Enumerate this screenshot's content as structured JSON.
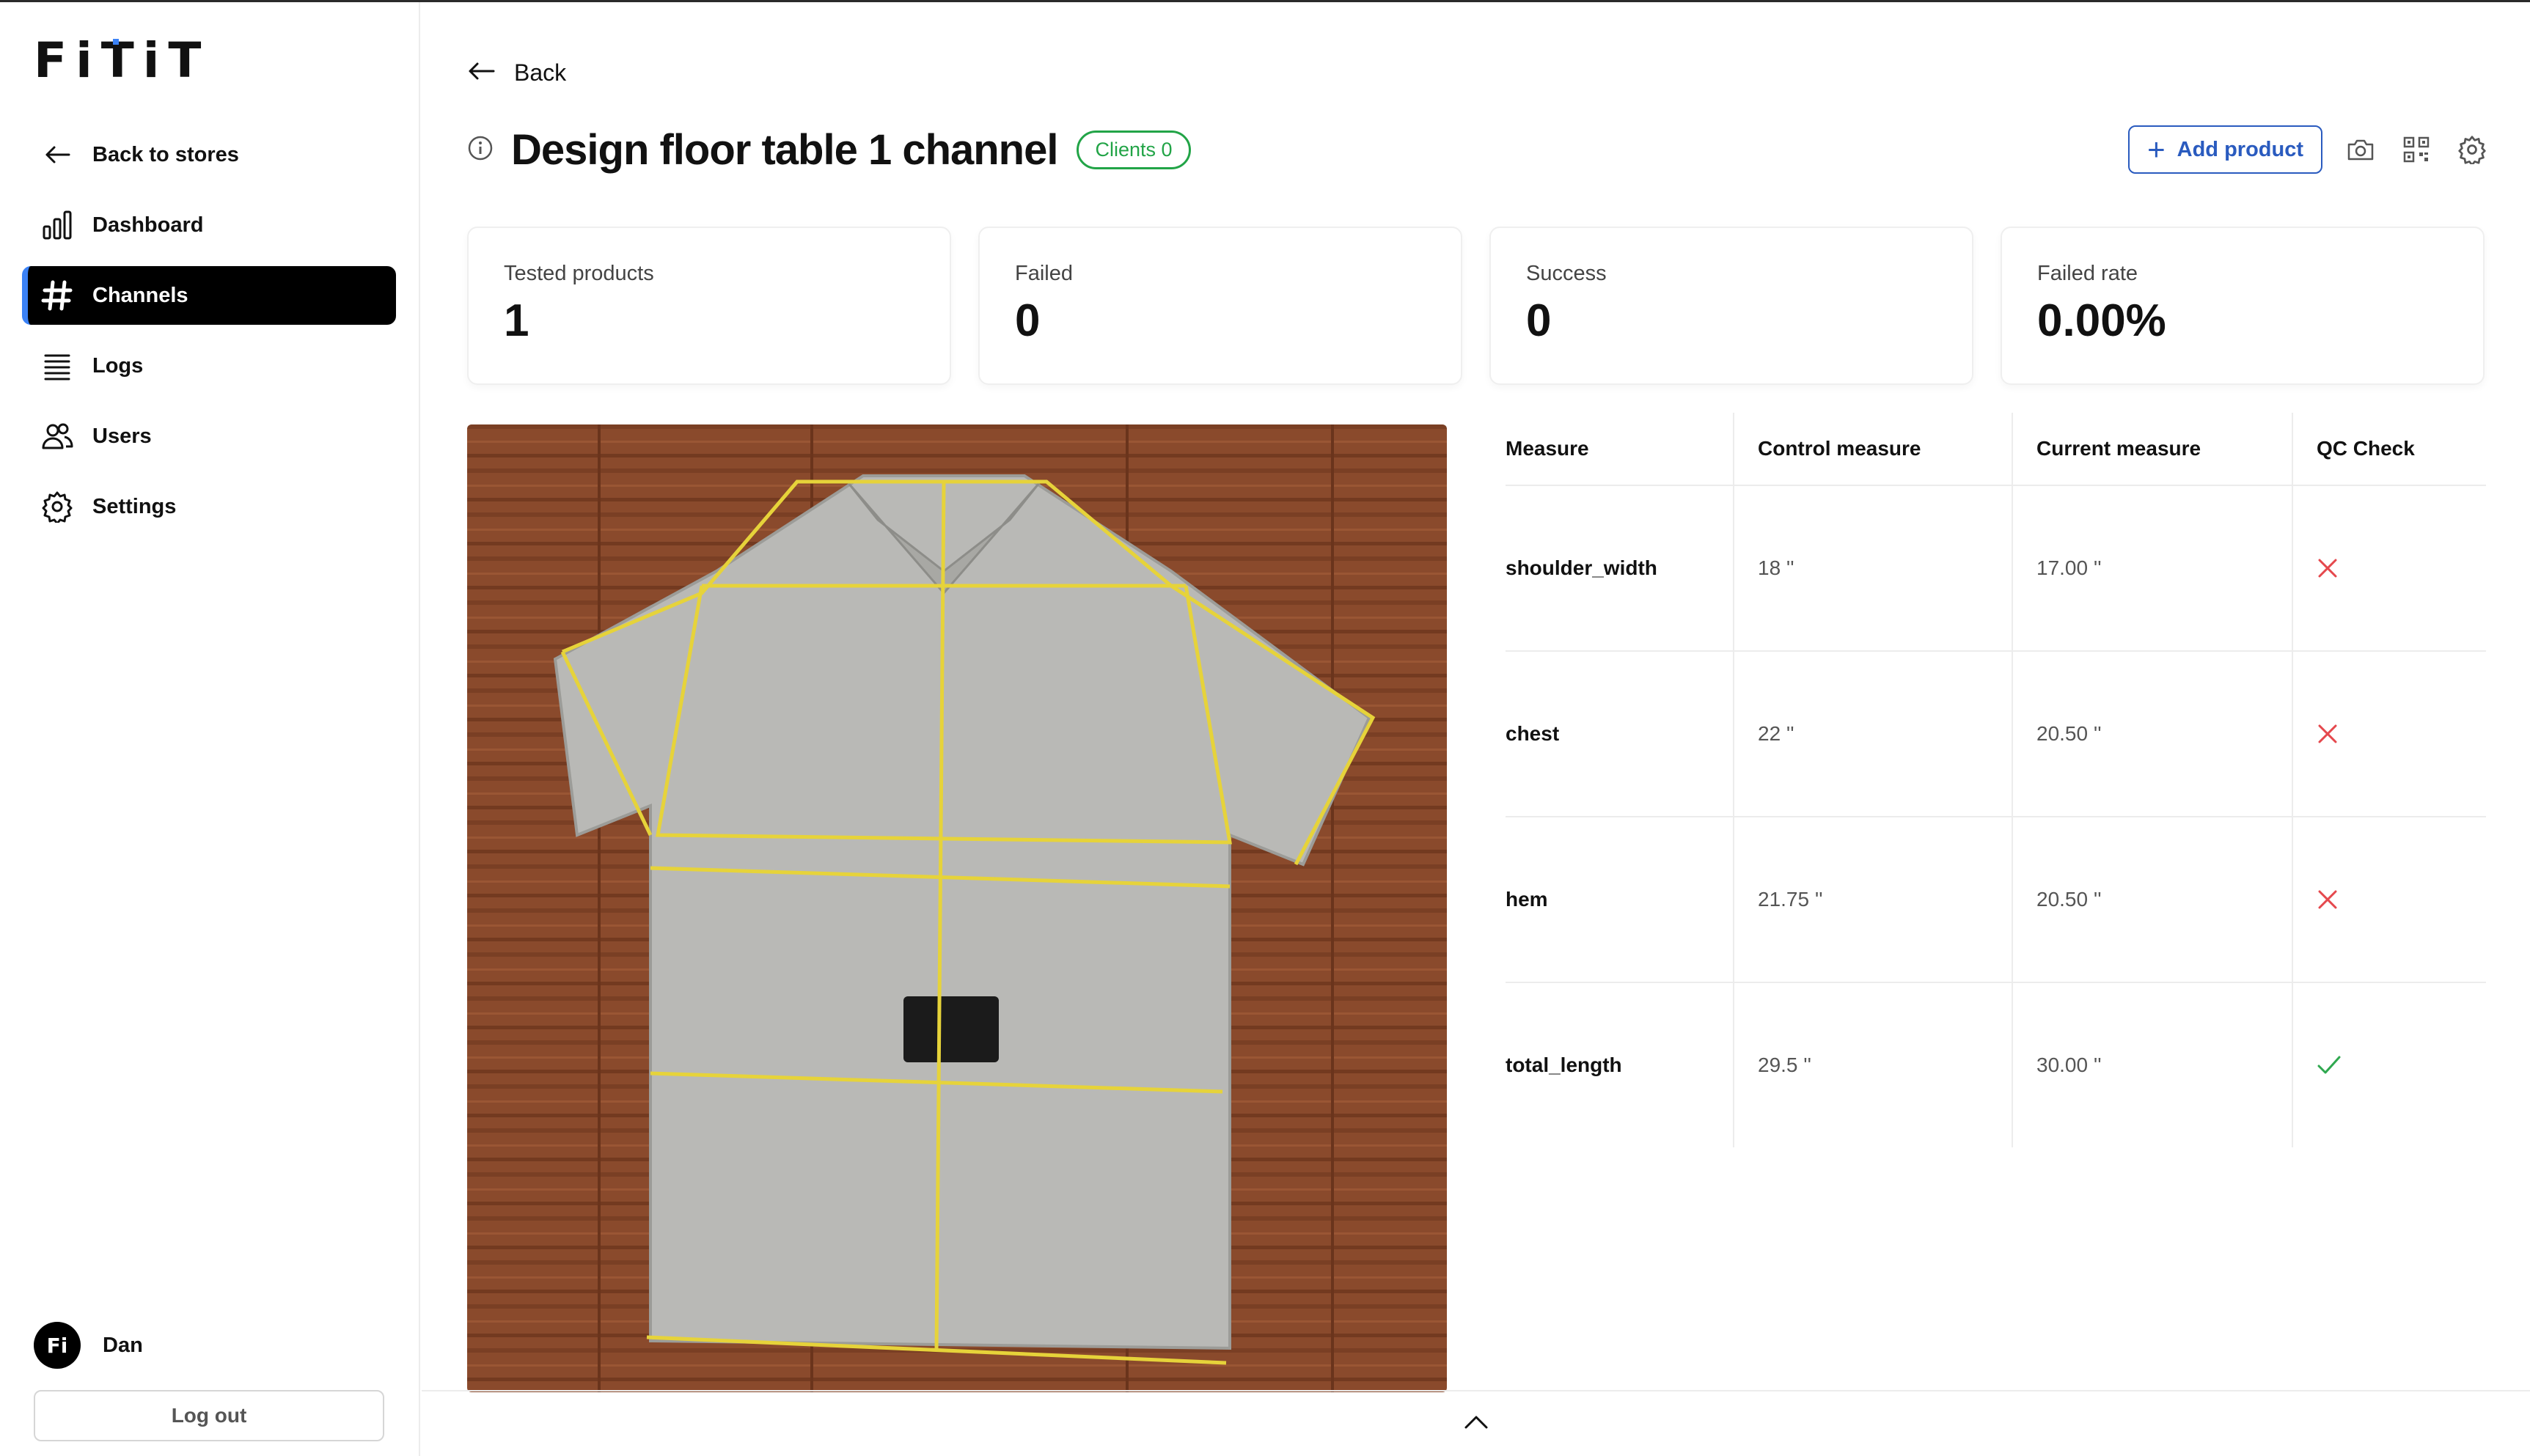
{
  "sidebar": {
    "logo": "FiTiT",
    "items": [
      {
        "label": "Back to stores",
        "icon": "arrow-left-icon"
      },
      {
        "label": "Dashboard",
        "icon": "bar-chart-icon"
      },
      {
        "label": "Channels",
        "icon": "hash-icon",
        "active": true
      },
      {
        "label": "Logs",
        "icon": "list-icon"
      },
      {
        "label": "Users",
        "icon": "users-icon"
      },
      {
        "label": "Settings",
        "icon": "gear-icon"
      }
    ],
    "user": {
      "initials": "Fi",
      "name": "Dan"
    },
    "logout_label": "Log out"
  },
  "header": {
    "back_label": "Back",
    "title": "Design floor table 1 channel",
    "badge": "Clients 0",
    "add_product_label": "Add product"
  },
  "stats": [
    {
      "label": "Tested products",
      "value": "1"
    },
    {
      "label": "Failed",
      "value": "0"
    },
    {
      "label": "Success",
      "value": "0"
    },
    {
      "label": "Failed rate",
      "value": "0.00%"
    }
  ],
  "table": {
    "headers": [
      "Measure",
      "Control measure",
      "Current measure",
      "QC Check"
    ],
    "rows": [
      {
        "measure": "shoulder_width",
        "control": "18 ''",
        "current": "17.00 ''",
        "qc": "fail"
      },
      {
        "measure": "chest",
        "control": "22 ''",
        "current": "20.50 ''",
        "qc": "fail"
      },
      {
        "measure": "hem",
        "control": "21.75 ''",
        "current": "20.50 ''",
        "qc": "fail"
      },
      {
        "measure": "total_length",
        "control": "29.5 ''",
        "current": "30.00 ''",
        "qc": "pass"
      }
    ]
  },
  "colors": {
    "accent": "#3b82f6",
    "primary_button": "#2a5bbf",
    "badge_green": "#22a447",
    "fail_red": "#e5484d",
    "pass_green": "#2fa84f",
    "measure_line": "#e6d33a",
    "wood": "#8a4a2c"
  }
}
